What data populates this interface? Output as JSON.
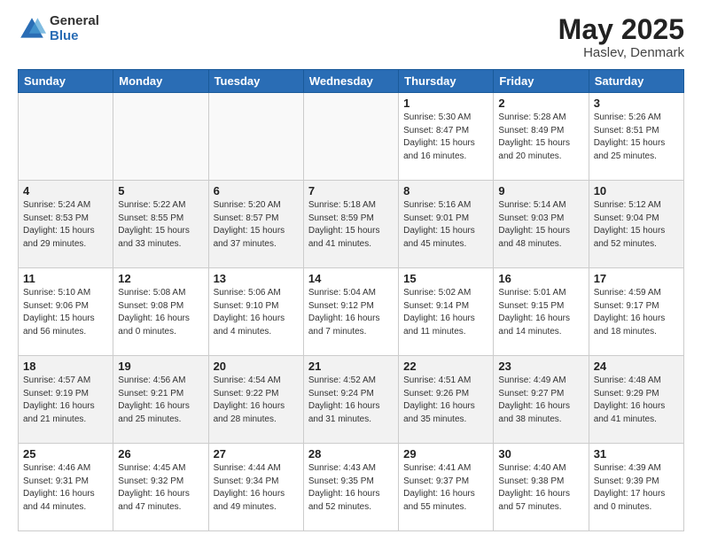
{
  "header": {
    "logo_general": "General",
    "logo_blue": "Blue",
    "main_title": "May 2025",
    "subtitle": "Haslev, Denmark"
  },
  "days_of_week": [
    "Sunday",
    "Monday",
    "Tuesday",
    "Wednesday",
    "Thursday",
    "Friday",
    "Saturday"
  ],
  "weeks": [
    [
      {
        "day": "",
        "info": ""
      },
      {
        "day": "",
        "info": ""
      },
      {
        "day": "",
        "info": ""
      },
      {
        "day": "",
        "info": ""
      },
      {
        "day": "1",
        "info": "Sunrise: 5:30 AM\nSunset: 8:47 PM\nDaylight: 15 hours\nand 16 minutes."
      },
      {
        "day": "2",
        "info": "Sunrise: 5:28 AM\nSunset: 8:49 PM\nDaylight: 15 hours\nand 20 minutes."
      },
      {
        "day": "3",
        "info": "Sunrise: 5:26 AM\nSunset: 8:51 PM\nDaylight: 15 hours\nand 25 minutes."
      }
    ],
    [
      {
        "day": "4",
        "info": "Sunrise: 5:24 AM\nSunset: 8:53 PM\nDaylight: 15 hours\nand 29 minutes."
      },
      {
        "day": "5",
        "info": "Sunrise: 5:22 AM\nSunset: 8:55 PM\nDaylight: 15 hours\nand 33 minutes."
      },
      {
        "day": "6",
        "info": "Sunrise: 5:20 AM\nSunset: 8:57 PM\nDaylight: 15 hours\nand 37 minutes."
      },
      {
        "day": "7",
        "info": "Sunrise: 5:18 AM\nSunset: 8:59 PM\nDaylight: 15 hours\nand 41 minutes."
      },
      {
        "day": "8",
        "info": "Sunrise: 5:16 AM\nSunset: 9:01 PM\nDaylight: 15 hours\nand 45 minutes."
      },
      {
        "day": "9",
        "info": "Sunrise: 5:14 AM\nSunset: 9:03 PM\nDaylight: 15 hours\nand 48 minutes."
      },
      {
        "day": "10",
        "info": "Sunrise: 5:12 AM\nSunset: 9:04 PM\nDaylight: 15 hours\nand 52 minutes."
      }
    ],
    [
      {
        "day": "11",
        "info": "Sunrise: 5:10 AM\nSunset: 9:06 PM\nDaylight: 15 hours\nand 56 minutes."
      },
      {
        "day": "12",
        "info": "Sunrise: 5:08 AM\nSunset: 9:08 PM\nDaylight: 16 hours\nand 0 minutes."
      },
      {
        "day": "13",
        "info": "Sunrise: 5:06 AM\nSunset: 9:10 PM\nDaylight: 16 hours\nand 4 minutes."
      },
      {
        "day": "14",
        "info": "Sunrise: 5:04 AM\nSunset: 9:12 PM\nDaylight: 16 hours\nand 7 minutes."
      },
      {
        "day": "15",
        "info": "Sunrise: 5:02 AM\nSunset: 9:14 PM\nDaylight: 16 hours\nand 11 minutes."
      },
      {
        "day": "16",
        "info": "Sunrise: 5:01 AM\nSunset: 9:15 PM\nDaylight: 16 hours\nand 14 minutes."
      },
      {
        "day": "17",
        "info": "Sunrise: 4:59 AM\nSunset: 9:17 PM\nDaylight: 16 hours\nand 18 minutes."
      }
    ],
    [
      {
        "day": "18",
        "info": "Sunrise: 4:57 AM\nSunset: 9:19 PM\nDaylight: 16 hours\nand 21 minutes."
      },
      {
        "day": "19",
        "info": "Sunrise: 4:56 AM\nSunset: 9:21 PM\nDaylight: 16 hours\nand 25 minutes."
      },
      {
        "day": "20",
        "info": "Sunrise: 4:54 AM\nSunset: 9:22 PM\nDaylight: 16 hours\nand 28 minutes."
      },
      {
        "day": "21",
        "info": "Sunrise: 4:52 AM\nSunset: 9:24 PM\nDaylight: 16 hours\nand 31 minutes."
      },
      {
        "day": "22",
        "info": "Sunrise: 4:51 AM\nSunset: 9:26 PM\nDaylight: 16 hours\nand 35 minutes."
      },
      {
        "day": "23",
        "info": "Sunrise: 4:49 AM\nSunset: 9:27 PM\nDaylight: 16 hours\nand 38 minutes."
      },
      {
        "day": "24",
        "info": "Sunrise: 4:48 AM\nSunset: 9:29 PM\nDaylight: 16 hours\nand 41 minutes."
      }
    ],
    [
      {
        "day": "25",
        "info": "Sunrise: 4:46 AM\nSunset: 9:31 PM\nDaylight: 16 hours\nand 44 minutes."
      },
      {
        "day": "26",
        "info": "Sunrise: 4:45 AM\nSunset: 9:32 PM\nDaylight: 16 hours\nand 47 minutes."
      },
      {
        "day": "27",
        "info": "Sunrise: 4:44 AM\nSunset: 9:34 PM\nDaylight: 16 hours\nand 49 minutes."
      },
      {
        "day": "28",
        "info": "Sunrise: 4:43 AM\nSunset: 9:35 PM\nDaylight: 16 hours\nand 52 minutes."
      },
      {
        "day": "29",
        "info": "Sunrise: 4:41 AM\nSunset: 9:37 PM\nDaylight: 16 hours\nand 55 minutes."
      },
      {
        "day": "30",
        "info": "Sunrise: 4:40 AM\nSunset: 9:38 PM\nDaylight: 16 hours\nand 57 minutes."
      },
      {
        "day": "31",
        "info": "Sunrise: 4:39 AM\nSunset: 9:39 PM\nDaylight: 17 hours\nand 0 minutes."
      }
    ]
  ]
}
